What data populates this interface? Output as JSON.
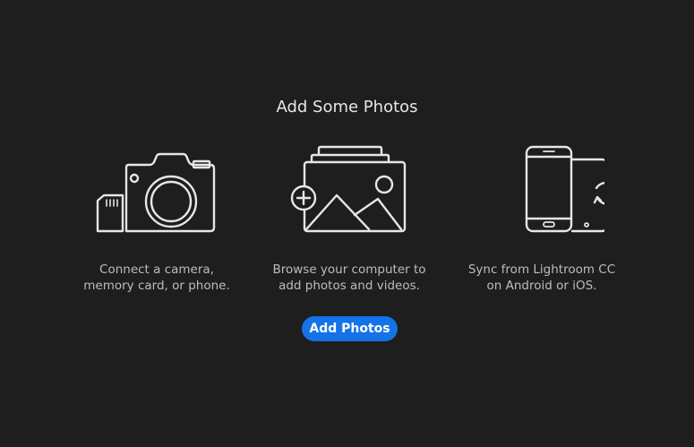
{
  "page": {
    "title": "Add Some Photos"
  },
  "options": {
    "camera": {
      "icon": "camera-with-memory-card-icon",
      "line1": "Connect a camera,",
      "line2": "memory card, or phone."
    },
    "browse": {
      "icon": "add-photos-stack-icon",
      "line1": "Browse your computer to",
      "line2": "add photos and videos."
    },
    "sync": {
      "icon": "mobile-sync-icon",
      "line1": "Sync from Lightroom CC",
      "line2": "on Android or iOS."
    }
  },
  "actions": {
    "add_photos_label": "Add Photos"
  },
  "colors": {
    "background": "#1e1e1e",
    "icon_stroke": "#e6e6e6",
    "caption_text": "#bdbdbd",
    "button_blue": "#1473e6"
  }
}
